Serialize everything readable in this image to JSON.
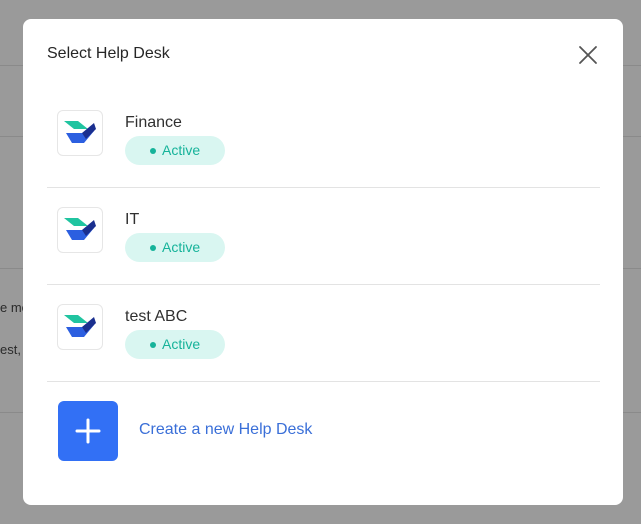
{
  "modal": {
    "title": "Select Help Desk",
    "close_icon": "close-icon"
  },
  "background": {
    "fragments": [
      "e me",
      "est,"
    ]
  },
  "help_desks": [
    {
      "name": "Finance",
      "status": "Active",
      "icon": "helpdesk-logo-icon"
    },
    {
      "name": "IT",
      "status": "Active",
      "icon": "helpdesk-logo-icon"
    },
    {
      "name": "test ABC",
      "status": "Active",
      "icon": "helpdesk-logo-icon"
    }
  ],
  "create": {
    "label": "Create a new Help Desk",
    "icon": "plus-icon"
  },
  "colors": {
    "accent_blue": "#3270f5",
    "link_blue": "#3a6fd8",
    "status_green": "#16b39a",
    "status_bg": "#d9f6f1",
    "logo_teal": "#20c4a0",
    "logo_blue": "#2c5fe0",
    "logo_navy": "#1a2f8f"
  }
}
